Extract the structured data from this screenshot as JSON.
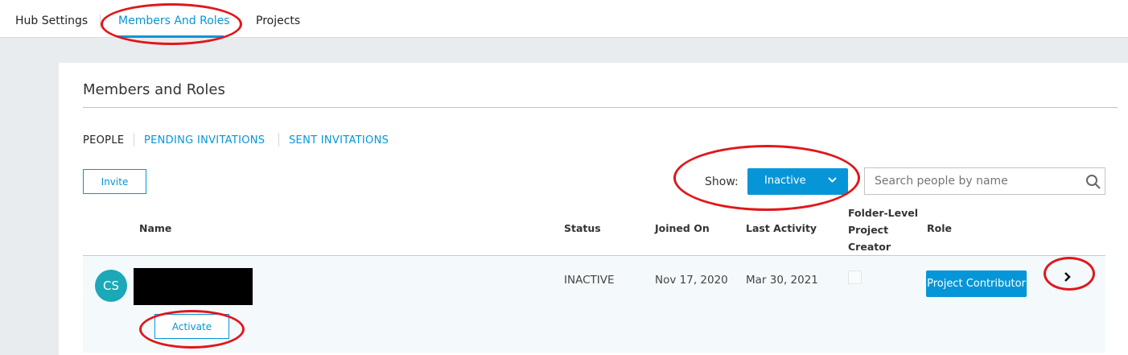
{
  "top_tabs": [
    "Hub Settings",
    "Members And Roles",
    "Projects"
  ],
  "page_title": "Members and Roles",
  "sub_tabs": [
    "PEOPLE",
    "PENDING INVITATIONS",
    "SENT INVITATIONS"
  ],
  "invite_label": "Invite",
  "show_label": "Show:",
  "show_value": "Inactive",
  "search_placeholder": "Search people by name",
  "columns": {
    "name": "Name",
    "status": "Status",
    "joined": "Joined On",
    "last": "Last Activity",
    "folder": [
      "Folder-Level",
      "Project",
      "Creator"
    ],
    "role": "Role"
  },
  "row": {
    "initials": "CS",
    "status": "INACTIVE",
    "joined": "Nov 17, 2020",
    "last": "Mar 30, 2021",
    "folder_checked": false,
    "role": "Project Contributor",
    "activate_label": "Activate"
  },
  "colors": {
    "accent": "#0696d7",
    "avatar": "#1ba8b8",
    "annotation": "#e0171b"
  }
}
